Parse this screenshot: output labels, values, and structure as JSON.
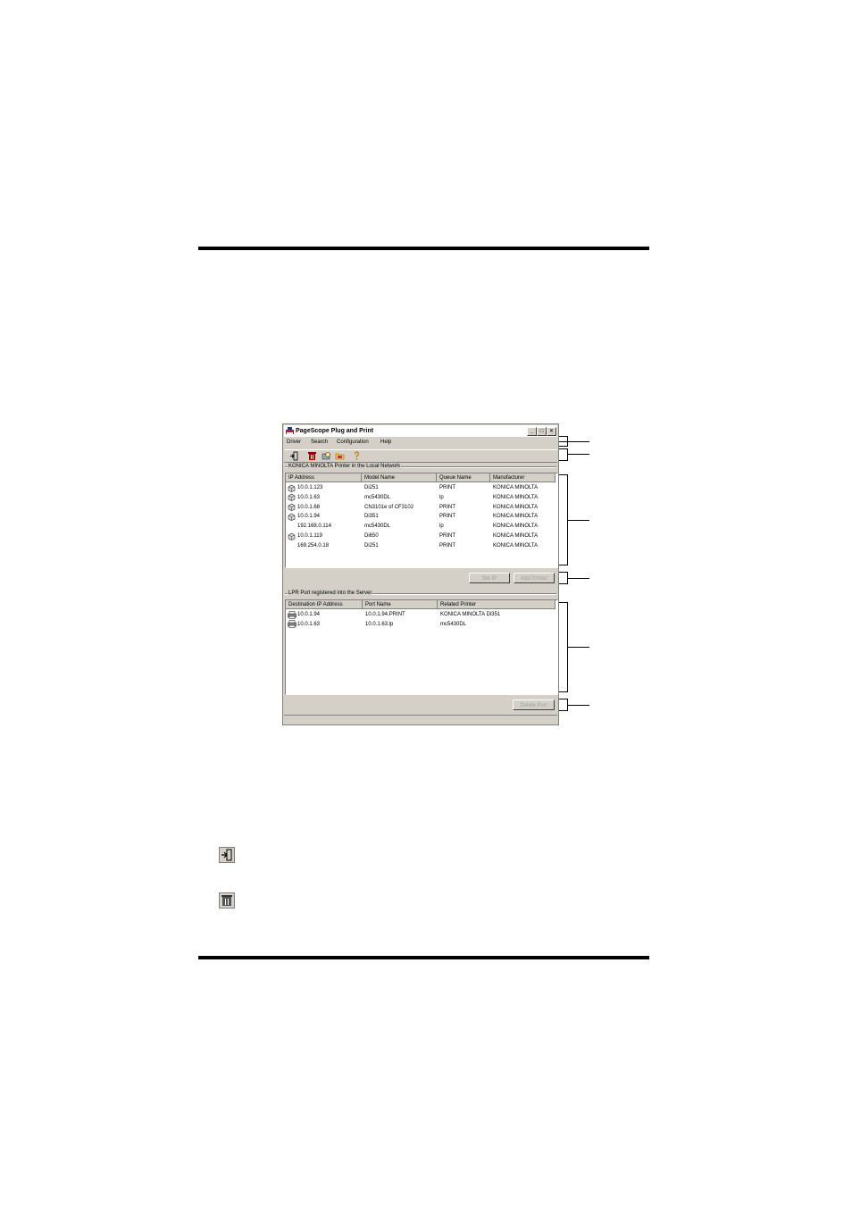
{
  "window": {
    "title": "PageScope Plug and Print",
    "controls": [
      "minimize",
      "maximize",
      "close"
    ]
  },
  "menu": [
    "Driver",
    "Search",
    "Configuration",
    "Help"
  ],
  "toolbar_icons": [
    "exit-icon",
    "delete-printer-icon",
    "search-printer-icon",
    "folder-icon",
    "help-icon"
  ],
  "printers_group": {
    "label": "KONICA MINOLTA Printer in the Local Network",
    "columns": [
      "IP Address",
      "Model Name",
      "Queue Name",
      "Manufacturer"
    ],
    "rows": [
      {
        "ip": "10.0.1.123",
        "model": "Di251",
        "queue": "PRINT",
        "manufacturer": "KONICA MINOLTA",
        "icon": true
      },
      {
        "ip": "10.0.1.63",
        "model": "mc5430DL",
        "queue": "lp",
        "manufacturer": "KONICA MINOLTA",
        "icon": true
      },
      {
        "ip": "10.0.1.68",
        "model": "CN3101e of CF3102",
        "queue": "PRINT",
        "manufacturer": "KONICA MINOLTA",
        "icon": true
      },
      {
        "ip": "10.0.1.94",
        "model": "Di351",
        "queue": "PRINT",
        "manufacturer": "KONICA MINOLTA",
        "icon": true
      },
      {
        "ip": "192.168.0.114",
        "model": "mc5430DL",
        "queue": "lp",
        "manufacturer": "KONICA MINOLTA",
        "icon": false
      },
      {
        "ip": "10.0.1.119",
        "model": "Di650",
        "queue": "PRINT",
        "manufacturer": "KONICA MINOLTA",
        "icon": true
      },
      {
        "ip": "169.254.0.18",
        "model": "Di251",
        "queue": "PRINT",
        "manufacturer": "KONICA MINOLTA",
        "icon": false
      }
    ],
    "buttons": {
      "set_ip": "Set IP",
      "add_printer": "Add Printer"
    }
  },
  "ports_group": {
    "label": "LPR Port registered into the Server",
    "columns": [
      "Destination IP Address",
      "Port Name",
      "Related Printer"
    ],
    "rows": [
      {
        "dest": "10.0.1.94",
        "port": "10.0.1.94.PRINT",
        "printer": "KONICA MINOLTA Di351"
      },
      {
        "dest": "10.0.1.63",
        "port": "10.0.1.63.lp",
        "printer": "mc5430DL"
      }
    ],
    "buttons": {
      "delete_port": "Delete Port"
    }
  },
  "legend_icons": [
    "exit-icon",
    "delete-printer-icon"
  ]
}
